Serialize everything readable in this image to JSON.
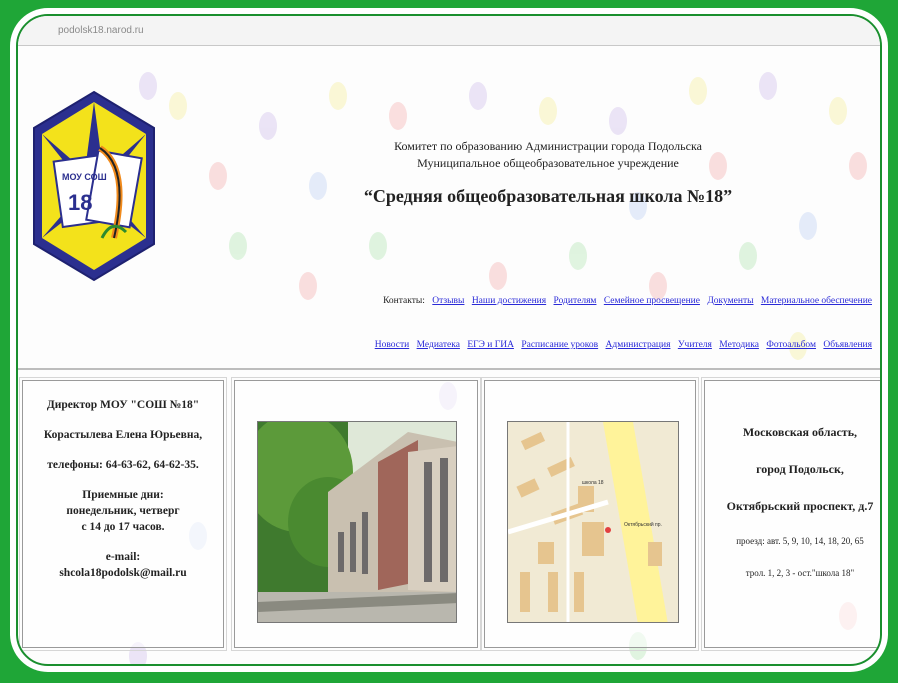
{
  "browser": {
    "address": "podolsk18.narod.ru"
  },
  "header": {
    "line1": "Комитет по образованию Администрации города Подольска",
    "line2": "Муниципальное общеобразовательное учреждение",
    "school_name": "“Средняя общеобразовательная школа №18”"
  },
  "logo": {
    "text_top": "МОУ СОШ",
    "number": "18"
  },
  "nav": {
    "row1_label": "Контакты",
    "row1": [
      "Отзывы",
      "Наши достижения",
      "Родителям",
      "Семейное просвещение",
      "Документы",
      "Материальное обеспечение"
    ],
    "row2": [
      "Новости",
      "Медиатека",
      "ЕГЭ и ГИА",
      "Расписание уроков",
      "Администрация",
      "Учителя",
      "Методика",
      "Фотоальбом",
      "Объявления"
    ]
  },
  "director": {
    "title": "Директор МОУ \"СОШ №18\"",
    "name": "Корастылева Елена Юрьевна,",
    "phones": "телефоны: 64-63-62, 64-62-35.",
    "reception_title": "Приемные дни:",
    "reception_days": "понедельник, четверг",
    "reception_time": "с 14 до 17 часов.",
    "email_label": "e-mail:",
    "email": "shcola18podolsk@mail.ru"
  },
  "address": {
    "region": "Московская область,",
    "city": "город Подольск,",
    "street": "Октябрьский проспект, д.7",
    "bus": "проезд: авт. 5, 9, 10, 14, 18, 20, 65",
    "trolley": "трол. 1, 2, 3 - ост.\"школа 18\""
  },
  "map": {
    "label_school": "школа 18",
    "label_street": "Октябрьский пр."
  },
  "colors": {
    "outer_green": "#1fa637",
    "link_blue": "#2a2ad8"
  }
}
